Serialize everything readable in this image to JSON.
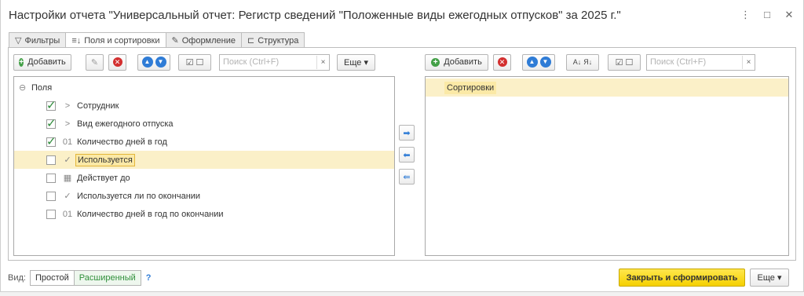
{
  "window": {
    "title": "Настройки отчета \"Универсальный отчет: Регистр сведений \"Положенные виды ежегодных отпусков\" за 2025 г.\"",
    "controls": [
      "⋮",
      "□",
      "✕"
    ]
  },
  "tabs": [
    {
      "icon": "filter-icon",
      "label": "Фильтры"
    },
    {
      "icon": "sort-fields-icon",
      "label": "Поля и сортировки"
    },
    {
      "icon": "brush-icon",
      "label": "Оформление"
    },
    {
      "icon": "structure-icon",
      "label": "Структура"
    }
  ],
  "left_toolbar": {
    "add_label": "Добавить",
    "search_placeholder": "Поиск (Ctrl+F)",
    "clear": "×",
    "more_label": "Еще ▾"
  },
  "right_toolbar": {
    "add_label": "Добавить",
    "search_placeholder": "Поиск (Ctrl+F)",
    "clear": "×"
  },
  "fields": {
    "root_label": "Поля",
    "root_marker": "⊖",
    "items": [
      {
        "checked": true,
        "marker": ">",
        "label": "Сотрудник"
      },
      {
        "checked": true,
        "marker": ">",
        "label": "Вид ежегодного отпуска"
      },
      {
        "checked": true,
        "marker": "01",
        "label": "Количество дней в год"
      },
      {
        "checked": false,
        "marker": "✓",
        "label": "Используется",
        "selected": true
      },
      {
        "checked": false,
        "marker": "▦",
        "label": "Действует до"
      },
      {
        "checked": false,
        "marker": "✓",
        "label": "Используется ли по окончании"
      },
      {
        "checked": false,
        "marker": "01",
        "label": "Количество дней в год по окончании"
      }
    ]
  },
  "sorting": {
    "root_label": "Сортировки"
  },
  "footer": {
    "view_label": "Вид:",
    "simple_label": "Простой",
    "extended_label": "Расширенный",
    "help": "?",
    "submit_label": "Закрыть и сформировать",
    "more_label": "Еще ▾"
  },
  "colors": {
    "accent_yellow": "#f5d000",
    "selection": "#fbf0c8",
    "check_green": "#2e8b3a",
    "arrow_blue": "#2f7cd6"
  }
}
